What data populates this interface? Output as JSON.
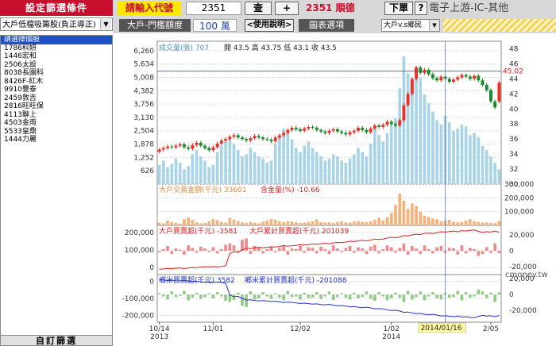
{
  "left_panel": {
    "title": "設定篩選條件",
    "filter": "大戶低檔吸籌股(負正導正)",
    "list_header": "請選擇個股",
    "stocks": [
      {
        "code": "1786",
        "name": "科妍"
      },
      {
        "code": "1446",
        "name": "宏和"
      },
      {
        "code": "2506",
        "name": "太設"
      },
      {
        "code": "8038",
        "name": "長園科"
      },
      {
        "code": "8426",
        "name": "F-紅木"
      },
      {
        "code": "9910",
        "name": "豐泰"
      },
      {
        "code": "2459",
        "name": "敦吉"
      },
      {
        "code": "2816",
        "name": "旺旺保"
      },
      {
        "code": "4113",
        "name": "聯上"
      },
      {
        "code": "4503",
        "name": "金雨"
      },
      {
        "code": "5533",
        "name": "皇鼎"
      },
      {
        "code": "1444",
        "name": "力麗"
      }
    ],
    "custom_button": "自訂篩選"
  },
  "toolbar": {
    "prompt": "請輸入代號",
    "code_value": "2351",
    "query_label": "查",
    "plus_label": "+",
    "stock_title": "2351 順德",
    "next_label": "下單",
    "help_icon_label": "?",
    "industry": "電子上游-IC-其他"
  },
  "toolbar2": {
    "label": "大戶-門檻額度",
    "threshold": "100 萬",
    "help": "<使用說明>",
    "chart_options": "圖表選項",
    "compare": "大戶v.s鄉民"
  },
  "chart_data": {
    "type": "candlestick-multi-panel",
    "price_panel": {
      "legend_volume": "成交量(張) 707",
      "ohlc_text": "開 43.5  高 43.75  低 43.1  收 43.5",
      "current_price_label": "45.02",
      "left_ticks": [
        "6,260",
        "5,634",
        "5,008",
        "4,382",
        "3,756",
        "3,130",
        "2,504",
        "1,878",
        "1,252",
        "626"
      ],
      "right_ticks": [
        "48",
        "46",
        "44",
        "42",
        "40",
        "38",
        "36",
        "34",
        "32",
        "30"
      ],
      "price_range": [
        30,
        49
      ],
      "volume_range": [
        0,
        6700
      ],
      "close": [
        34.6,
        34.8,
        35.0,
        34.9,
        35.1,
        35.3,
        34.9,
        34.7,
        35.2,
        35.5,
        35.1,
        34.8,
        34.5,
        34.9,
        35.4,
        35.8,
        36.0,
        36.3,
        36.5,
        36.2,
        36.0,
        35.8,
        36.1,
        36.4,
        36.2,
        36.0,
        35.9,
        35.7,
        36.2,
        36.5,
        36.8,
        37.2,
        37.5,
        37.3,
        37.1,
        37.4,
        37.6,
        37.5,
        37.2,
        37.0,
        36.8,
        37.1,
        37.3,
        37.0,
        36.8,
        36.6,
        36.9,
        37.1,
        37.5,
        37.2,
        36.9,
        37.4,
        37.8,
        37.6,
        37.9,
        38.3,
        38.0,
        37.8,
        38.5,
        40.5,
        42.0,
        44.0,
        45.5,
        44.8,
        45.2,
        44.6,
        44.1,
        43.8,
        44.3,
        44.0,
        43.6,
        43.9,
        44.2,
        44.5,
        44.3,
        44.0,
        44.4,
        43.8,
        43.2,
        42.5,
        41.0,
        40.2,
        43.5
      ],
      "open": [
        34.3,
        34.6,
        34.8,
        35.0,
        34.9,
        35.1,
        35.3,
        34.9,
        34.7,
        35.2,
        35.5,
        35.1,
        34.8,
        34.5,
        34.9,
        35.4,
        35.8,
        36.0,
        36.3,
        36.5,
        36.2,
        36.0,
        35.8,
        36.1,
        36.4,
        36.2,
        36.0,
        35.9,
        35.7,
        36.2,
        36.5,
        36.8,
        37.2,
        37.5,
        37.3,
        37.1,
        37.4,
        37.6,
        37.5,
        37.2,
        37.0,
        36.8,
        37.1,
        37.3,
        37.0,
        36.8,
        36.6,
        36.9,
        37.1,
        37.5,
        37.2,
        36.9,
        37.4,
        37.8,
        37.6,
        37.9,
        38.3,
        38.0,
        37.8,
        38.5,
        40.5,
        42.0,
        44.0,
        45.5,
        44.8,
        45.2,
        44.6,
        44.1,
        43.8,
        44.3,
        44.0,
        43.6,
        43.9,
        44.2,
        44.5,
        44.3,
        44.0,
        44.4,
        43.8,
        43.2,
        42.5,
        41.0,
        41.0
      ],
      "volume": [
        900,
        1100,
        800,
        950,
        1200,
        1000,
        700,
        850,
        1400,
        1600,
        1300,
        1100,
        800,
        900,
        1500,
        1800,
        2000,
        2200,
        1900,
        1600,
        1300,
        1400,
        1700,
        1500,
        1300,
        1200,
        1000,
        1100,
        1900,
        2300,
        2600,
        2400,
        2100,
        1700,
        1500,
        1800,
        2000,
        1700,
        1500,
        1300,
        1100,
        1200,
        1400,
        1300,
        1100,
        1000,
        1200,
        1400,
        1700,
        1500,
        1300,
        1900,
        2600,
        2300,
        2000,
        2400,
        2800,
        3100,
        4500,
        6000,
        5200,
        4700,
        5500,
        5000,
        4200,
        3800,
        3400,
        3000,
        2800,
        3200,
        2900,
        2500,
        2600,
        2800,
        2700,
        2300,
        2400,
        2200,
        1800,
        1600,
        1300,
        1000,
        700
      ]
    },
    "amount_panel": {
      "legend": "大戶交易金額(千元) 33601",
      "legend2": "含金量(%) -10.66",
      "right_ticks": [
        "300,000",
        "200,000",
        "100,000"
      ],
      "max": 300000,
      "values": [
        20000,
        15000,
        35000,
        25000,
        18000,
        12000,
        45000,
        60000,
        40000,
        22000,
        15000,
        18000,
        30000,
        45000,
        38000,
        25000,
        20000,
        55000,
        42000,
        30000,
        22000,
        18000,
        25000,
        20000,
        15000,
        28000,
        35000,
        48000,
        40000,
        30000,
        25000,
        32000,
        28000,
        22000,
        18000,
        20000,
        26000,
        30000,
        45000,
        24000,
        20000,
        22000,
        18000,
        25000,
        30000,
        22000,
        20000,
        28000,
        32000,
        26000,
        24000,
        30000,
        40000,
        55000,
        35000,
        60000,
        90000,
        150000,
        230000,
        180000,
        120000,
        160000,
        140000,
        100000,
        70000,
        60000,
        50000,
        45000,
        30000,
        35000,
        40000,
        28000,
        22000,
        25000,
        35000,
        45000,
        30000,
        25000,
        20000,
        22000,
        18000,
        15000,
        33601
      ]
    },
    "big_player_panel": {
      "legend": "大戶買賣超(千元) -3581",
      "legend2": "大戶累計買賣超(千元) 201039",
      "left_ticks": [
        "200,000",
        "100,000",
        "0"
      ],
      "right_ticks": [
        "20,000",
        "0",
        "-20,000"
      ],
      "daily": [
        -2000,
        3000,
        8000,
        -5000,
        4000,
        2000,
        -6000,
        9000,
        5000,
        -3000,
        7000,
        4000,
        -2000,
        6000,
        -4000,
        3000,
        10000,
        12000,
        9000,
        -3000,
        18000,
        20000,
        -5000,
        8000,
        6000,
        -4000,
        3000,
        7000,
        -2000,
        5000,
        9000,
        -6000,
        4000,
        3000,
        8000,
        -3000,
        6000,
        5000,
        -4000,
        7000,
        3000,
        -5000,
        9000,
        4000,
        -2000,
        5000,
        8000,
        -3000,
        6000,
        4000,
        -5000,
        7000,
        10000,
        -4000,
        3000,
        9000,
        6000,
        -3000,
        5000,
        12000,
        -6000,
        8000,
        4000,
        -5000,
        9000,
        3000,
        -4000,
        6000,
        8000,
        -3000,
        5000,
        4000,
        -6000,
        9000,
        -4000,
        5000,
        3000,
        -8000,
        -5000,
        6000,
        -3000,
        12000,
        -3581
      ],
      "cumulative": [
        -10000,
        -8000,
        -5000,
        -7000,
        -4000,
        -3000,
        -6000,
        -2000,
        0,
        -1000,
        3000,
        5000,
        4000,
        6000,
        4000,
        6000,
        10000,
        80000,
        90000,
        88000,
        100000,
        110000,
        108000,
        112000,
        115000,
        113000,
        115000,
        118000,
        117000,
        120000,
        125000,
        122000,
        124000,
        126000,
        130000,
        128000,
        131000,
        134000,
        132000,
        136000,
        138000,
        135000,
        140000,
        143000,
        142000,
        145000,
        150000,
        148000,
        152000,
        155000,
        152000,
        156000,
        162000,
        160000,
        162000,
        168000,
        172000,
        170000,
        174000,
        182000,
        180000,
        186000,
        190000,
        188000,
        194000,
        196000,
        194000,
        198000,
        204000,
        202000,
        205000,
        208000,
        204000,
        210000,
        208000,
        212000,
        214000,
        206000,
        200000,
        204000,
        202000,
        208000,
        201039
      ]
    },
    "retail_panel": {
      "legend": "鄉米買賣超(千元) 3582",
      "legend2": "鄉米累計買賣超(千元) -201088",
      "left_ticks": [
        "0",
        "-100,000",
        "-200,000"
      ],
      "right_ticks": [
        "20,000",
        "0",
        "-20,000"
      ],
      "daily": [
        2000,
        -3000,
        -8000,
        5000,
        -4000,
        -2000,
        6000,
        -9000,
        -5000,
        3000,
        -7000,
        -4000,
        2000,
        -6000,
        4000,
        -3000,
        -10000,
        -12000,
        -9000,
        3000,
        -18000,
        -20000,
        5000,
        -8000,
        -6000,
        4000,
        -3000,
        -7000,
        2000,
        -5000,
        -9000,
        6000,
        -4000,
        -3000,
        -8000,
        3000,
        -6000,
        -5000,
        4000,
        -7000,
        -3000,
        5000,
        -9000,
        -4000,
        2000,
        -5000,
        -8000,
        3000,
        -6000,
        -4000,
        5000,
        -7000,
        -10000,
        4000,
        -3000,
        -9000,
        -6000,
        3000,
        -5000,
        -12000,
        6000,
        -8000,
        -4000,
        5000,
        -9000,
        -3000,
        4000,
        -6000,
        -8000,
        3000,
        -5000,
        -4000,
        6000,
        -9000,
        4000,
        -5000,
        -3000,
        8000,
        5000,
        -6000,
        3000,
        -12000,
        3582
      ],
      "cumulative": [
        10000,
        8000,
        5000,
        7000,
        4000,
        3000,
        6000,
        2000,
        0,
        1000,
        -3000,
        -5000,
        -4000,
        -6000,
        -4000,
        -6000,
        -10000,
        -80000,
        -90000,
        -88000,
        -100000,
        -110000,
        -108000,
        -112000,
        -115000,
        -113000,
        -115000,
        -118000,
        -117000,
        -120000,
        -125000,
        -122000,
        -124000,
        -126000,
        -130000,
        -128000,
        -131000,
        -134000,
        -132000,
        -136000,
        -138000,
        -135000,
        -140000,
        -143000,
        -142000,
        -145000,
        -150000,
        -148000,
        -152000,
        -155000,
        -152000,
        -156000,
        -162000,
        -160000,
        -162000,
        -168000,
        -172000,
        -170000,
        -174000,
        -182000,
        -180000,
        -186000,
        -190000,
        -188000,
        -194000,
        -196000,
        -194000,
        -198000,
        -204000,
        -202000,
        -205000,
        -208000,
        -204000,
        -210000,
        -208000,
        -212000,
        -214000,
        -206000,
        -200000,
        -204000,
        -202000,
        -208000,
        -201088
      ]
    },
    "x_labels": [
      {
        "text": "10/14",
        "sub": "2013",
        "idx": 0
      },
      {
        "text": "11/01",
        "sub": "",
        "idx": 13
      },
      {
        "text": "12/02",
        "sub": "",
        "idx": 34
      },
      {
        "text": "1/02",
        "sub": "2014",
        "idx": 56
      },
      {
        "text": "2/05",
        "sub": "",
        "idx": 80
      }
    ],
    "crosshair": {
      "idx": 69,
      "date_label": "2014/01/16"
    },
    "colors": {
      "up": "#e8332a",
      "down": "#1a8a2a",
      "volume": "#a9d4e6",
      "amount": "#f5b27a",
      "big_bar": "#ee8a8a",
      "retail_bar": "#94c98a",
      "big_line": "#d62020",
      "retail_line": "#2233cc",
      "crosshair": "#6677cc"
    }
  },
  "watermark": "cmoney.tw"
}
